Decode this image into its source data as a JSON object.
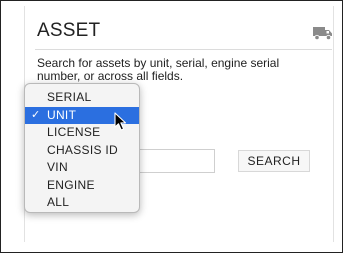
{
  "panel": {
    "title": "ASSET",
    "description": "Search for assets by unit, serial, engine serial number, or across all fields."
  },
  "icons": {
    "truck": "truck-icon",
    "check": "checkmark-icon",
    "cursor": "mouse-pointer-icon"
  },
  "dropdown": {
    "options": [
      {
        "label": "SERIAL",
        "selected": false
      },
      {
        "label": "UNIT",
        "selected": true
      },
      {
        "label": "LICENSE",
        "selected": false
      },
      {
        "label": "CHASSIS ID",
        "selected": false
      },
      {
        "label": "VIN",
        "selected": false
      },
      {
        "label": "ENGINE",
        "selected": false
      },
      {
        "label": "ALL",
        "selected": false
      }
    ],
    "check_glyph": "✓"
  },
  "search": {
    "value": "",
    "button_label": "SEARCH"
  },
  "colors": {
    "selected_bg": "#2b6fe0",
    "selected_text": "#ffffff",
    "truck_gray": "#8a8a8a"
  }
}
